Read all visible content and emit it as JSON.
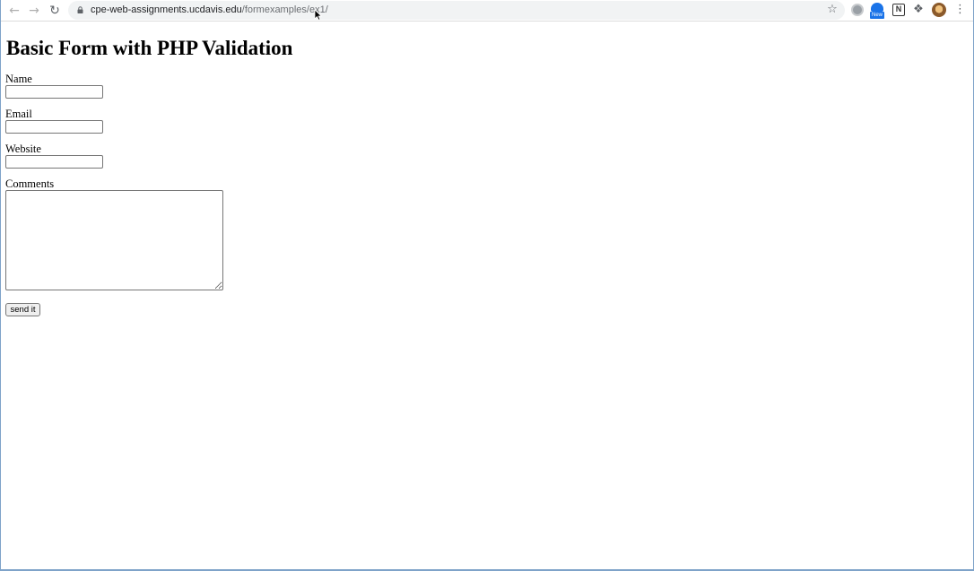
{
  "browser": {
    "url_host": "cpe-web-assignments.ucdavis.edu",
    "url_path": "/formexamples/ex1/",
    "back_icon": "arrow-left",
    "forward_icon": "arrow-right",
    "reload_icon": "reload",
    "bookmark_icon": "star",
    "extension_new_badge": "New",
    "extension_notion": "N",
    "extensions_icon": "puzzle",
    "menu_icon": "kebab"
  },
  "page": {
    "title": "Basic Form with PHP Validation",
    "form": {
      "name_label": "Name",
      "name_value": "",
      "email_label": "Email",
      "email_value": "",
      "website_label": "Website",
      "website_value": "",
      "comments_label": "Comments",
      "comments_value": "",
      "submit_label": "send it"
    }
  }
}
